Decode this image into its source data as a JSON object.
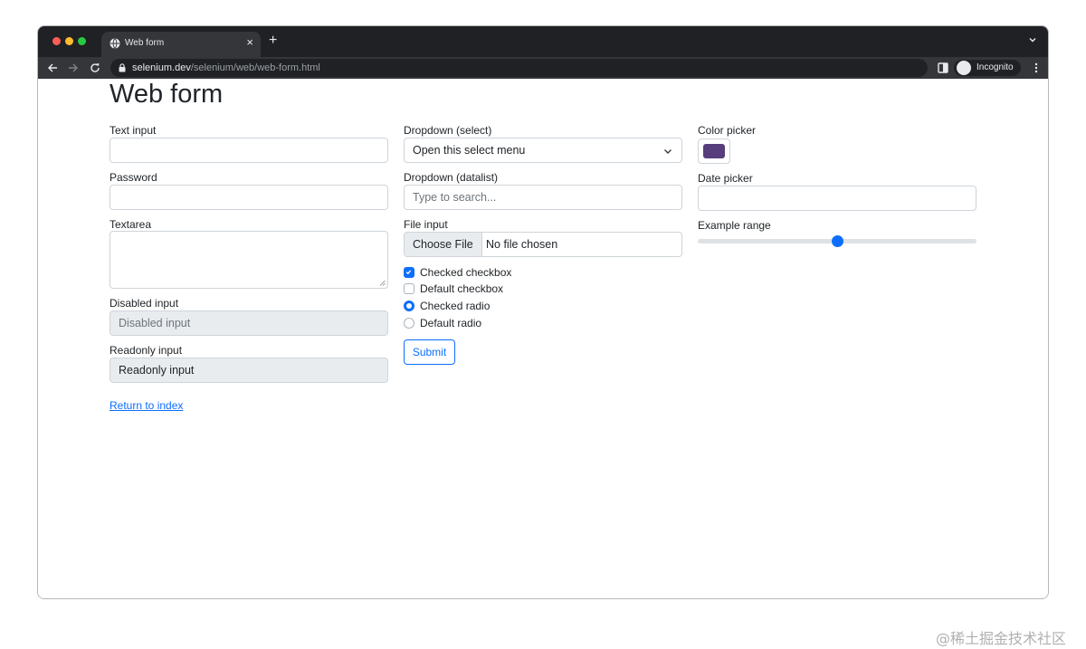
{
  "browser": {
    "tab_title": "Web form",
    "tab_close": "×",
    "new_tab": "+",
    "url_host": "selenium.dev",
    "url_path": "/selenium/web/web-form.html",
    "profile_label": "Incognito"
  },
  "page": {
    "title": "Web form",
    "text_input": {
      "label": "Text input",
      "value": ""
    },
    "password": {
      "label": "Password",
      "value": ""
    },
    "textarea": {
      "label": "Textarea",
      "value": ""
    },
    "disabled_input": {
      "label": "Disabled input",
      "placeholder": "Disabled input"
    },
    "readonly_input": {
      "label": "Readonly input",
      "value": "Readonly input"
    },
    "dropdown_select": {
      "label": "Dropdown (select)",
      "selected": "Open this select menu"
    },
    "dropdown_datalist": {
      "label": "Dropdown (datalist)",
      "placeholder": "Type to search..."
    },
    "file_input": {
      "label": "File input",
      "button": "Choose File",
      "status": "No file chosen"
    },
    "checkboxes": [
      {
        "label": "Checked checkbox",
        "checked": true
      },
      {
        "label": "Default checkbox",
        "checked": false
      }
    ],
    "radios": [
      {
        "label": "Checked radio",
        "checked": true
      },
      {
        "label": "Default radio",
        "checked": false
      }
    ],
    "submit_label": "Submit",
    "color_picker": {
      "label": "Color picker",
      "value": "#563d7c"
    },
    "date_picker": {
      "label": "Date picker",
      "value": ""
    },
    "range": {
      "label": "Example range",
      "value": 0.5
    },
    "return_link": "Return to index"
  },
  "colors": {
    "accent": "#0d6efd",
    "chrome_dark": "#202124",
    "chrome_toolbar": "#35363a"
  },
  "watermark": "@稀土掘金技术社区"
}
